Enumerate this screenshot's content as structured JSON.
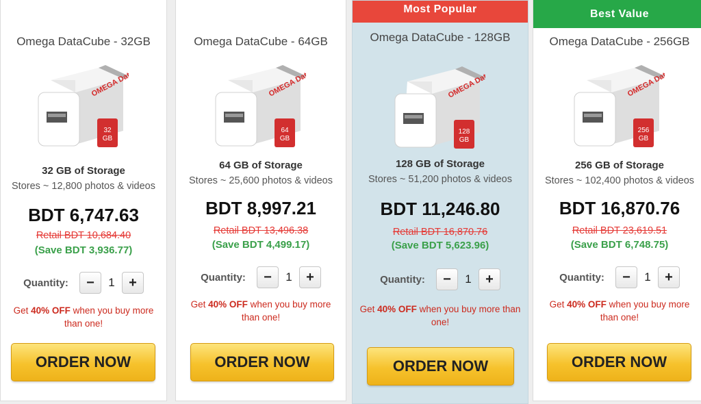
{
  "brand_logo_text": "OMEGA DataCube",
  "colors": {
    "ribbon_popular": "#e8473b",
    "ribbon_value": "#27a848",
    "price_strike": "#e53935",
    "save_green": "#3aa04a",
    "button_gold": "#f6c22c"
  },
  "cards": [
    {
      "ribbon": "",
      "title": "Omega DataCube - 32GB",
      "sd_label_line1": "32",
      "sd_label_line2": "GB",
      "storage": "32 GB of Storage",
      "stores": "Stores ~ 12,800 photos & videos",
      "price": "BDT 6,747.63",
      "retail": "Retail BDT 10,684.40",
      "save": "(Save BDT 3,936.77)",
      "quantity_label": "Quantity:",
      "quantity": "1",
      "promo_prefix": "Get ",
      "promo_bold": "40% OFF",
      "promo_suffix": " when you buy more than one!",
      "order_label": "ORDER NOW"
    },
    {
      "ribbon": "",
      "title": "Omega DataCube - 64GB",
      "sd_label_line1": "64",
      "sd_label_line2": "GB",
      "storage": "64 GB of Storage",
      "stores": "Stores ~ 25,600 photos & videos",
      "price": "BDT 8,997.21",
      "retail": "Retail BDT 13,496.38",
      "save": "(Save BDT 4,499.17)",
      "quantity_label": "Quantity:",
      "quantity": "1",
      "promo_prefix": "Get ",
      "promo_bold": "40% OFF",
      "promo_suffix": " when you buy more than one!",
      "order_label": "ORDER NOW"
    },
    {
      "ribbon": "Most Popular",
      "title": "Omega DataCube - 128GB",
      "sd_label_line1": "128",
      "sd_label_line2": "GB",
      "storage": "128 GB of Storage",
      "stores": "Stores ~ 51,200 photos & videos",
      "price": "BDT 11,246.80",
      "retail": "Retail BDT 16,870.76",
      "save": "(Save BDT 5,623.96)",
      "quantity_label": "Quantity:",
      "quantity": "1",
      "promo_prefix": "Get ",
      "promo_bold": "40% OFF",
      "promo_suffix": " when you buy more than one!",
      "order_label": "ORDER NOW"
    },
    {
      "ribbon": "Best Value",
      "title": "Omega DataCube - 256GB",
      "sd_label_line1": "256",
      "sd_label_line2": "GB",
      "storage": "256 GB of Storage",
      "stores": "Stores ~ 102,400 photos & videos",
      "price": "BDT 16,870.76",
      "retail": "Retail BDT 23,619.51",
      "save": "(Save BDT 6,748.75)",
      "quantity_label": "Quantity:",
      "quantity": "1",
      "promo_prefix": "Get ",
      "promo_bold": "40% OFF",
      "promo_suffix": " when you buy more than one!",
      "order_label": "ORDER NOW"
    }
  ]
}
